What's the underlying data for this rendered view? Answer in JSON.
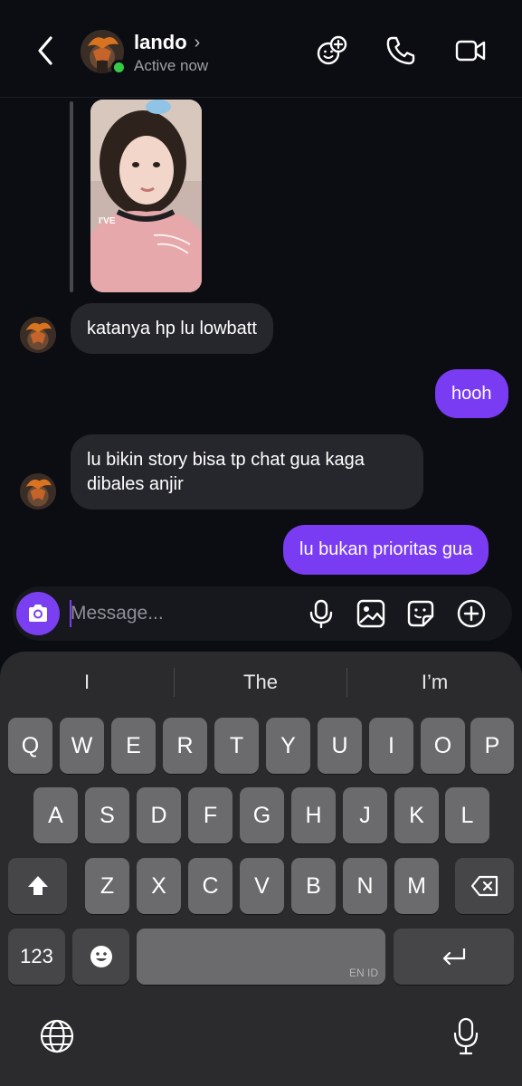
{
  "header": {
    "contact_name": "lando",
    "chevron": "›",
    "status": "Active now",
    "icons": [
      "back-chevron-icon",
      "add-effects-icon",
      "phone-call-icon",
      "video-call-icon"
    ]
  },
  "chat": {
    "story_label": "I'VE",
    "messages": [
      {
        "direction": "in",
        "text": "katanya hp lu lowbatt"
      },
      {
        "direction": "out",
        "text": "hooh"
      },
      {
        "direction": "in",
        "text": "lu bikin story bisa tp chat gua kaga dibales anjir"
      },
      {
        "direction": "out",
        "text": "lu bukan prioritas gua"
      }
    ]
  },
  "composer": {
    "placeholder": "Message...",
    "icons": [
      "camera-icon",
      "microphone-icon",
      "gallery-icon",
      "sticker-icon",
      "add-icon"
    ]
  },
  "keyboard": {
    "suggestions": [
      "I",
      "The",
      "I’m"
    ],
    "row1": [
      "Q",
      "W",
      "E",
      "R",
      "T",
      "Y",
      "U",
      "I",
      "O",
      "P"
    ],
    "row2": [
      "A",
      "S",
      "D",
      "F",
      "G",
      "H",
      "J",
      "K",
      "L"
    ],
    "row3": [
      "Z",
      "X",
      "C",
      "V",
      "B",
      "N",
      "M"
    ],
    "numbers_key": "123",
    "space_lang": "EN ID"
  },
  "colors": {
    "background": "#0c0d12",
    "incoming_bubble": "#26272d",
    "outgoing_bubble": "#7a3cf2",
    "accent": "#7b3ff2",
    "online": "#38c847"
  }
}
